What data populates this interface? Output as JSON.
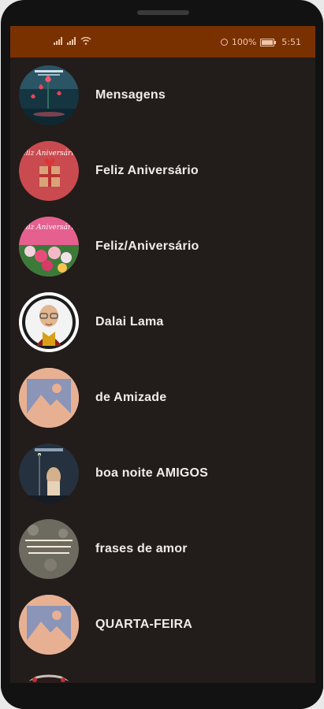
{
  "status_bar": {
    "battery": "100%",
    "time": "5:51",
    "battery_level": 1.0,
    "color": "#7a3100"
  },
  "list": {
    "items": [
      {
        "label": "Mensagens",
        "icon": "roses-photo"
      },
      {
        "label": "Feliz Aniversário",
        "icon": "gift-photo",
        "image_text": "Feliz Aniversário!"
      },
      {
        "label": "Feliz/Aniversário",
        "icon": "flowers-photo",
        "image_text": "Feliz Aniversário!"
      },
      {
        "label": "Dalai Lama",
        "icon": "dalai-lama-portrait"
      },
      {
        "label": "de Amizade",
        "icon": "image-placeholder-icon"
      },
      {
        "label": "boa noite AMIGOS",
        "icon": "night-photo"
      },
      {
        "label": "frases de amor",
        "icon": "love-phrase-photo"
      },
      {
        "label": "QUARTA-FEIRA",
        "icon": "image-placeholder-icon"
      }
    ]
  },
  "colors": {
    "background": "#221c1a",
    "text": "#f1ece8",
    "placeholder": "#e8b093"
  }
}
